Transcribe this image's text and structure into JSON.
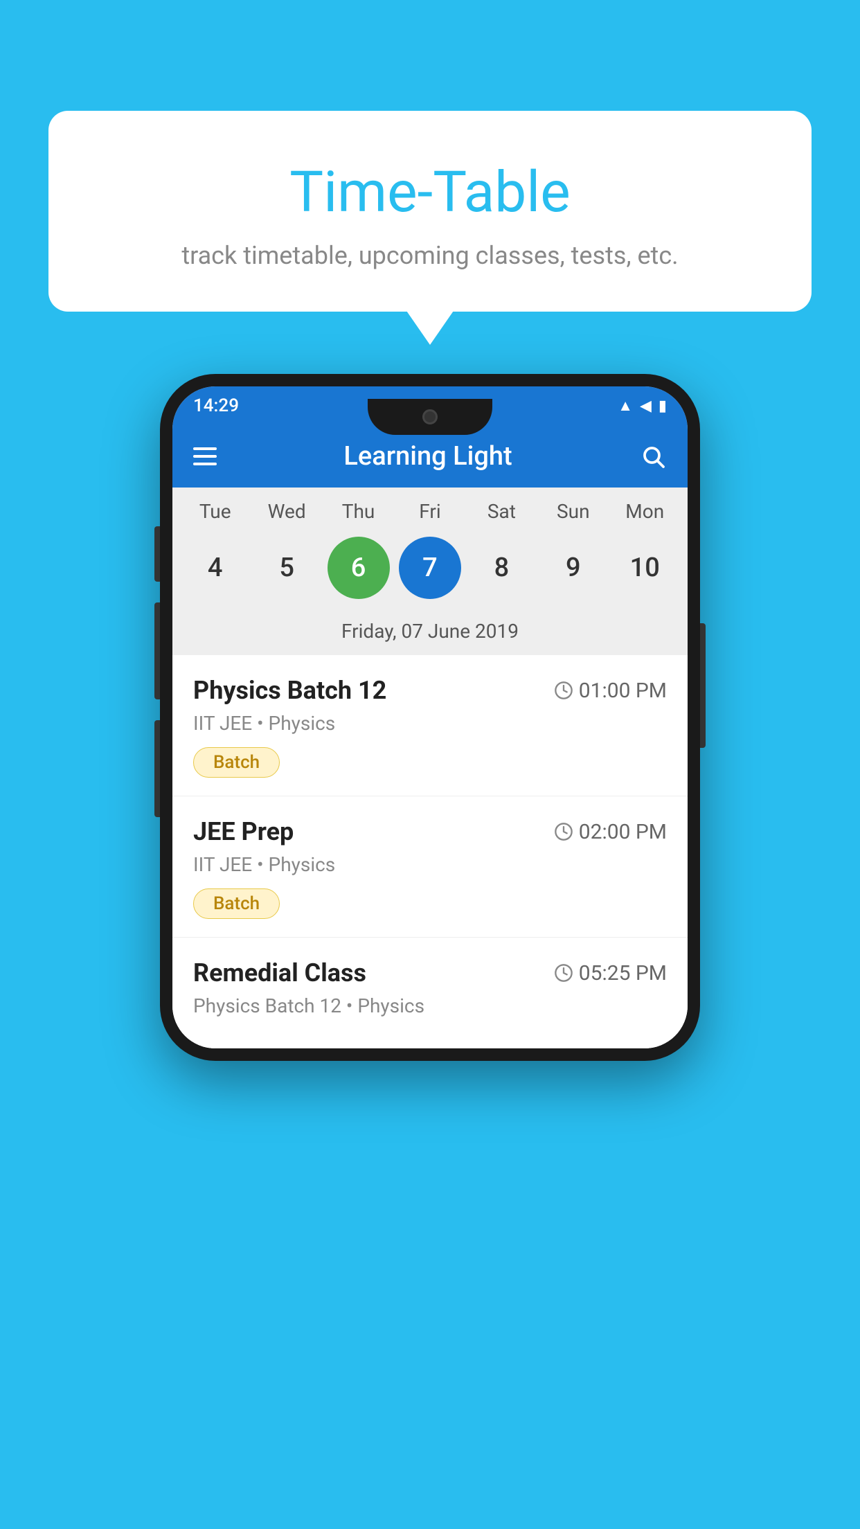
{
  "background_color": "#29BDEF",
  "bubble": {
    "title": "Time-Table",
    "subtitle": "track timetable, upcoming classes, tests, etc."
  },
  "phone": {
    "status_bar": {
      "time": "14:29",
      "icons": [
        "wifi",
        "signal",
        "battery"
      ]
    },
    "app_bar": {
      "title": "Learning Light"
    },
    "calendar": {
      "days": [
        {
          "name": "Tue",
          "num": "4",
          "state": "normal"
        },
        {
          "name": "Wed",
          "num": "5",
          "state": "normal"
        },
        {
          "name": "Thu",
          "num": "6",
          "state": "today"
        },
        {
          "name": "Fri",
          "num": "7",
          "state": "selected"
        },
        {
          "name": "Sat",
          "num": "8",
          "state": "normal"
        },
        {
          "name": "Sun",
          "num": "9",
          "state": "normal"
        },
        {
          "name": "Mon",
          "num": "10",
          "state": "normal"
        }
      ],
      "selected_label": "Friday, 07 June 2019"
    },
    "schedule": [
      {
        "title": "Physics Batch 12",
        "time": "01:00 PM",
        "meta": "IIT JEE • Physics",
        "badge": "Batch"
      },
      {
        "title": "JEE Prep",
        "time": "02:00 PM",
        "meta": "IIT JEE • Physics",
        "badge": "Batch"
      },
      {
        "title": "Remedial Class",
        "time": "05:25 PM",
        "meta": "Physics Batch 12 • Physics",
        "badge": null
      }
    ]
  }
}
